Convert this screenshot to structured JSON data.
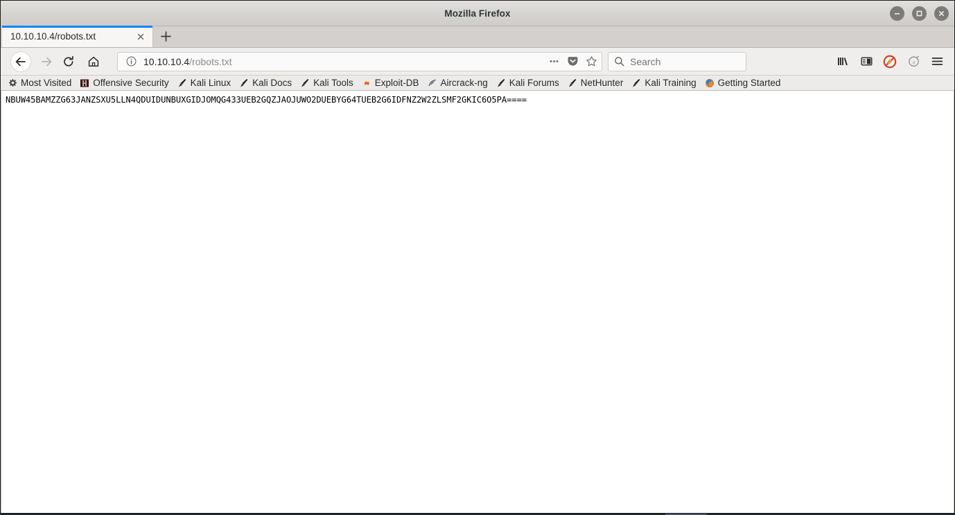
{
  "window": {
    "title": "Mozilla Firefox",
    "controls": [
      {
        "name": "minimize",
        "glyph": "minus"
      },
      {
        "name": "maximize",
        "glyph": "square"
      },
      {
        "name": "close",
        "glyph": "cross"
      }
    ]
  },
  "tabs": {
    "active": {
      "label": "10.10.10.4/robots.txt",
      "close_label": "×"
    },
    "new_tab_label": "+"
  },
  "navigation": {
    "back_tooltip": "Back",
    "forward_tooltip": "Forward",
    "reload_tooltip": "Reload",
    "home_tooltip": "Home"
  },
  "urlbar": {
    "identity_icon": "info-icon",
    "host": "10.10.10.4",
    "path": "/robots.txt",
    "full_url": "10.10.10.4/robots.txt",
    "page_actions_label": "•••",
    "pocket_label": "Save to Pocket",
    "bookmark_label": "Bookmark this page"
  },
  "search": {
    "placeholder": "Search",
    "value": ""
  },
  "toolbar_right": {
    "library_label": "Library",
    "sidebar_label": "Sidebars",
    "noscript_label": "NoScript",
    "extension_label": "Extension",
    "menu_label": "Open menu"
  },
  "bookmarks": [
    {
      "label": "Most Visited",
      "icon": "gear-icon"
    },
    {
      "label": "Offensive Security",
      "icon": "offsec-icon"
    },
    {
      "label": "Kali Linux",
      "icon": "kali-icon"
    },
    {
      "label": "Kali Docs",
      "icon": "kali-icon"
    },
    {
      "label": "Kali Tools",
      "icon": "kali-icon"
    },
    {
      "label": "Exploit-DB",
      "icon": "exploitdb-icon"
    },
    {
      "label": "Aircrack-ng",
      "icon": "aircrack-icon"
    },
    {
      "label": "Kali Forums",
      "icon": "kali-icon"
    },
    {
      "label": "NetHunter",
      "icon": "kali-icon"
    },
    {
      "label": "Kali Training",
      "icon": "kali-icon"
    },
    {
      "label": "Getting Started",
      "icon": "firefox-icon"
    }
  ],
  "page": {
    "body_text": "NBUW45BAMZZG63JANZSXU5LLN4QDUIDUNBUXGIDJOMQG433UEB2GQZJAOJUWO2DUEBYG64TUEB2G6IDFNZ2W2ZLSMF2GKIC6O5PA===="
  },
  "colors": {
    "tab_accent": "#0a84ff",
    "chrome_bg": "#f0eeec",
    "titlebar_bg": "#d6d4d1",
    "text": "#2b2b2b"
  }
}
